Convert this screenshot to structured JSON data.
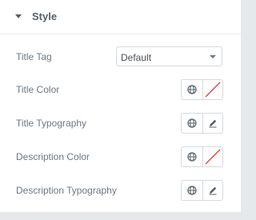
{
  "section": {
    "title": "Style",
    "caret_icon": "caret-down-icon"
  },
  "fields": {
    "title_tag": {
      "label": "Title Tag",
      "select_value": "Default"
    },
    "title_color": {
      "label": "Title Color",
      "globe_icon": "globe-icon",
      "swatch": "no-color-swatch"
    },
    "title_typography": {
      "label": "Title Typography",
      "globe_icon": "globe-icon",
      "edit_icon": "pencil-icon"
    },
    "description_color": {
      "label": "Description Color",
      "globe_icon": "globe-icon",
      "swatch": "no-color-swatch"
    },
    "description_typography": {
      "label": "Description Typography",
      "globe_icon": "globe-icon",
      "edit_icon": "pencil-icon"
    }
  },
  "colors": {
    "label_text": "#6d7882",
    "border": "#d5dadf",
    "swatch_slash": "#e02020",
    "background": "#e6e9ec"
  }
}
